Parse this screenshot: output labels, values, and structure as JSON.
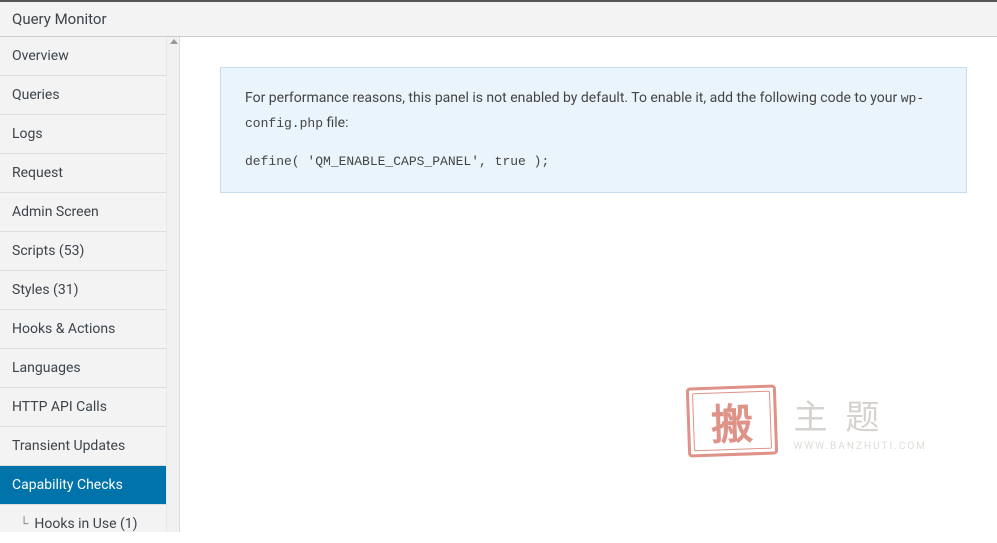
{
  "header": {
    "title": "Query Monitor"
  },
  "sidebar": {
    "items": [
      {
        "label": "Overview"
      },
      {
        "label": "Queries"
      },
      {
        "label": "Logs"
      },
      {
        "label": "Request"
      },
      {
        "label": "Admin Screen"
      },
      {
        "label": "Scripts (53)"
      },
      {
        "label": "Styles (31)"
      },
      {
        "label": "Hooks & Actions"
      },
      {
        "label": "Languages"
      },
      {
        "label": "HTTP API Calls"
      },
      {
        "label": "Transient Updates"
      },
      {
        "label": "Capability Checks"
      },
      {
        "label": "Hooks in Use (1)"
      }
    ]
  },
  "notice": {
    "text_before": "For performance reasons, this panel is not enabled by default. To enable it, add the following code to your ",
    "inline_code": "wp-config.php",
    "text_after": " file:",
    "code_block": "define( 'QM_ENABLE_CAPS_PANEL', true );"
  },
  "watermark": {
    "stamp_char": "搬",
    "chinese": "主题",
    "url": "WWW.BANZHUTI.COM"
  }
}
